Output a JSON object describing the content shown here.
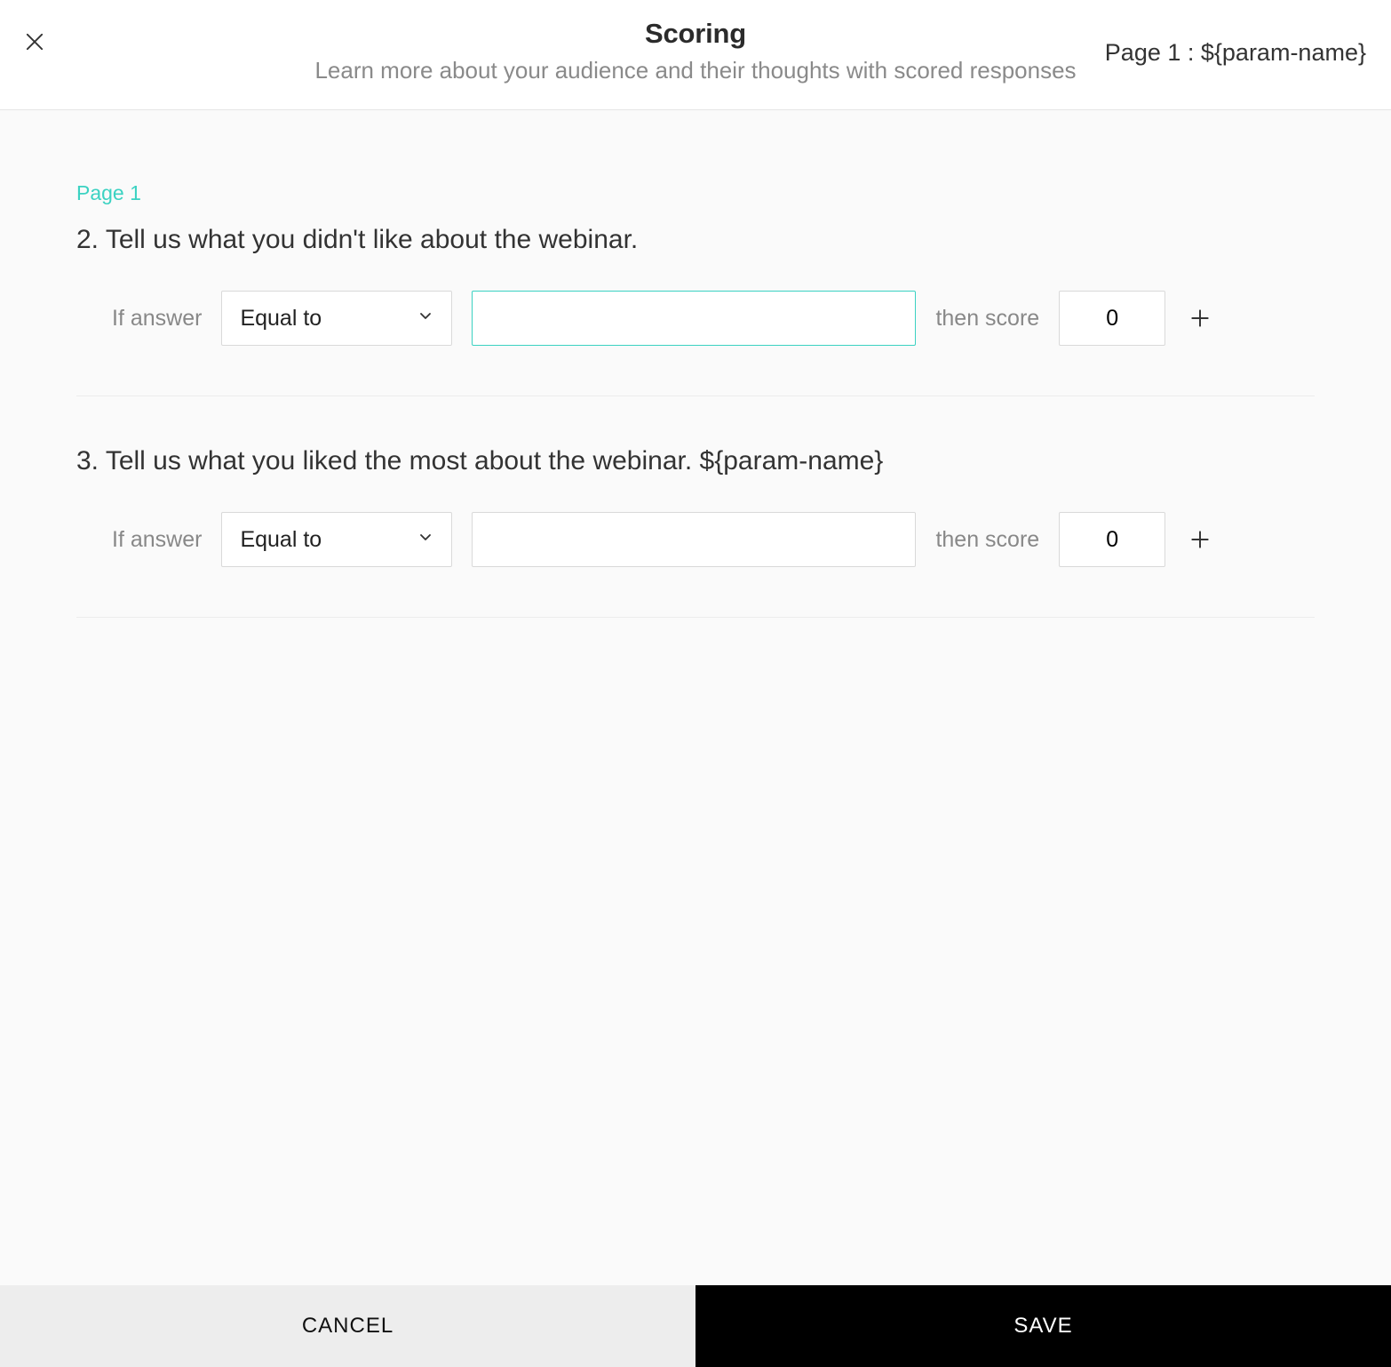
{
  "header": {
    "title": "Scoring",
    "subtitle": "Learn more about your audience and their thoughts with scored responses",
    "breadcrumb": "Page 1 : ${param-name}"
  },
  "page_label": "Page 1",
  "labels": {
    "if_answer": "If answer",
    "then_score": "then score"
  },
  "questions": [
    {
      "number": "2.",
      "text": "Tell us what you didn't like about the webinar.",
      "condition": "Equal to",
      "answer_value": "",
      "score": "0",
      "input_focused": true
    },
    {
      "number": "3.",
      "text": "Tell us what you liked the most about the webinar. ${param-name}",
      "condition": "Equal to",
      "answer_value": "",
      "score": "0",
      "input_focused": false
    }
  ],
  "condition_options": [
    "Equal to"
  ],
  "footer": {
    "cancel": "CANCEL",
    "save": "SAVE"
  }
}
